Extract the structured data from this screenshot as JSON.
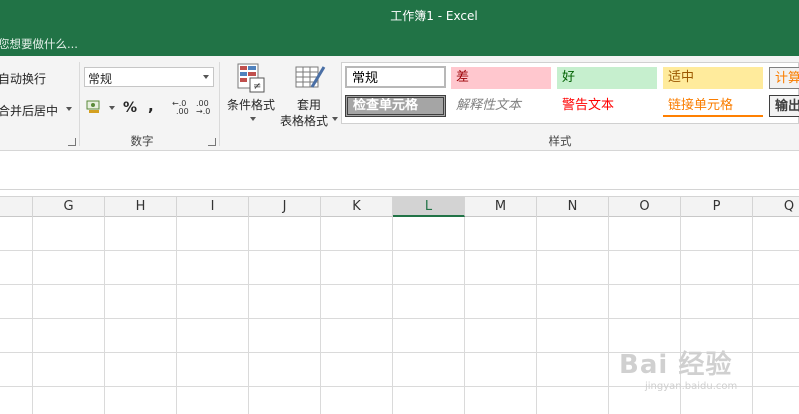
{
  "window": {
    "title": "工作簿1 - Excel"
  },
  "tell_me": {
    "placeholder": "您想要做什么..."
  },
  "ribbon": {
    "alignment": {
      "wrap_text": "自动换行",
      "merge_center": "合并后居中"
    },
    "number": {
      "format_value": "常规",
      "percent": "%",
      "comma": ",",
      "inc_decimal": "←.0 .00",
      "dec_decimal": ".00 →.0",
      "group_label": "数字"
    },
    "styles": {
      "conditional_format": "条件格式",
      "format_as_table_line1": "套用",
      "format_as_table_line2": "表格格式",
      "group_label": "样式",
      "cells": [
        {
          "label": "常规",
          "style": "normal"
        },
        {
          "label": "差",
          "style": "bad"
        },
        {
          "label": "好",
          "style": "good"
        },
        {
          "label": "适中",
          "style": "neutral"
        },
        {
          "label": "计算",
          "style": "calculation"
        },
        {
          "label": "检查单元格",
          "style": "check"
        },
        {
          "label": "解释性文本",
          "style": "explanatory"
        },
        {
          "label": "警告文本",
          "style": "warning"
        },
        {
          "label": "链接单元格",
          "style": "linked"
        },
        {
          "label": "输出",
          "style": "output"
        }
      ]
    }
  },
  "sheet": {
    "columns": [
      "G",
      "H",
      "I",
      "J",
      "K",
      "L",
      "M",
      "N",
      "O",
      "P",
      "Q"
    ],
    "selected_column": "L"
  },
  "watermark": {
    "brand": "Bai 经验",
    "url": "jingyan.baidu.com"
  },
  "colors": {
    "accent": "#217346",
    "bad_bg": "#ffc7ce",
    "good_bg": "#c6efce",
    "neutral_bg": "#ffeb9c"
  }
}
